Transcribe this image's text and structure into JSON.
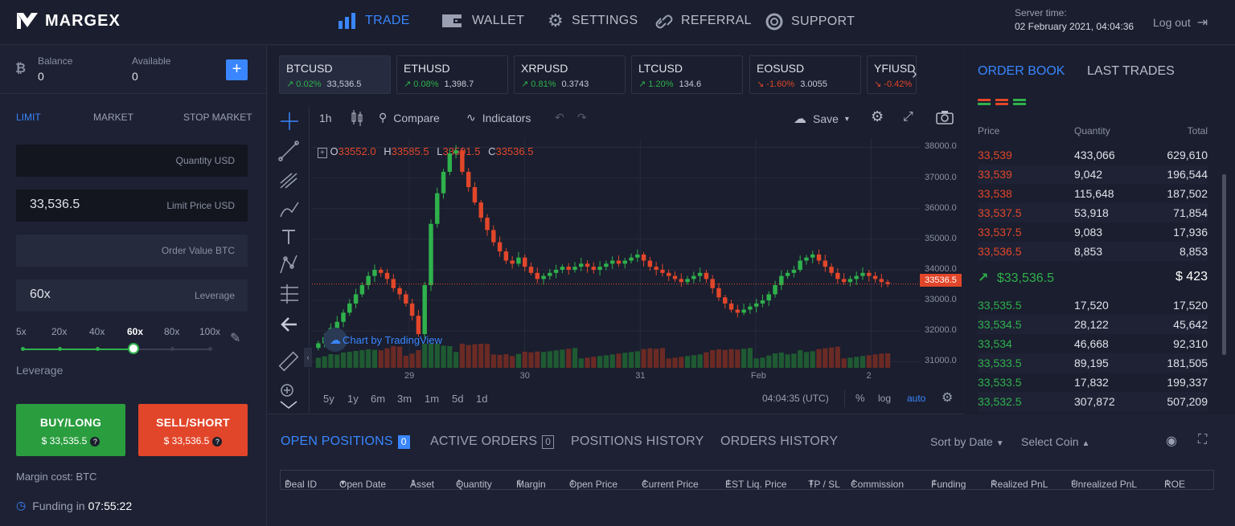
{
  "header": {
    "brand": "MARGEX",
    "nav": [
      {
        "label": "TRADE",
        "icon": "bar-chart-icon",
        "active": true
      },
      {
        "label": "WALLET",
        "icon": "wallet-icon",
        "active": false
      },
      {
        "label": "SETTINGS",
        "icon": "gear-icon",
        "active": false
      },
      {
        "label": "REFERRAL",
        "icon": "link-icon",
        "active": false
      },
      {
        "label": "SUPPORT",
        "icon": "lifebuoy-icon",
        "active": false
      }
    ],
    "server_time_label": "Server time:",
    "server_time_value": "02 February 2021, 04:04:36",
    "logout": "Log out"
  },
  "account": {
    "balance_label": "Balance",
    "balance_value": "0",
    "available_label": "Available",
    "available_value": "0",
    "add_symbol": "+"
  },
  "order_form": {
    "tabs": [
      "LIMIT",
      "MARKET",
      "STOP MARKET"
    ],
    "active_tab": "LIMIT",
    "quantity_placeholder": "Quantity USD",
    "limit_price_value": "33,536.5",
    "limit_price_placeholder": "Limit Price USD",
    "order_value_placeholder": "Order Value BTC",
    "leverage_value": "60x",
    "leverage_placeholder": "Leverage",
    "leverage_levels": [
      "5x",
      "20x",
      "40x",
      "60x",
      "80x",
      "100x"
    ],
    "leverage_selected": "60x",
    "leverage_caption": "Leverage",
    "buy_label": "BUY/LONG",
    "buy_price": "$ 33,535.5",
    "sell_label": "SELL/SHORT",
    "sell_price": "$ 33,536.5",
    "help_symbol": "?",
    "margin_cost": "Margin cost: BTC",
    "funding_label": "Funding in",
    "funding_value": "07:55:22"
  },
  "tickers": [
    {
      "symbol": "BTCUSD",
      "change": "0.02%",
      "price": "33,536.5",
      "dir": "up"
    },
    {
      "symbol": "ETHUSD",
      "change": "0.08%",
      "price": "1,398.7",
      "dir": "up"
    },
    {
      "symbol": "XRPUSD",
      "change": "0.81%",
      "price": "0.3743",
      "dir": "up"
    },
    {
      "symbol": "LTCUSD",
      "change": "1.20%",
      "price": "134.6",
      "dir": "up"
    },
    {
      "symbol": "EOSUSD",
      "change": "-1.60%",
      "price": "3.0055",
      "dir": "down"
    },
    {
      "symbol": "YFIUSD",
      "change": "-0.42%",
      "price": "3...",
      "dir": "down"
    }
  ],
  "chart_toolbar": {
    "interval": "1h",
    "compare": "Compare",
    "indicators": "Indicators",
    "save": "Save"
  },
  "ohlc": {
    "o": "33552.0",
    "h": "33585.5",
    "l": "33501.5",
    "c": "33536.5"
  },
  "watermark": "Chart by TradingView",
  "chart_data": {
    "type": "candlestick",
    "x_ticks": [
      "29",
      "30",
      "31",
      "Feb",
      "2"
    ],
    "y_ticks": [
      "38000.0",
      "37000.0",
      "36000.0",
      "35000.0",
      "34000.0",
      "33000.0",
      "32000.0",
      "31000.0"
    ],
    "ylim": [
      30800,
      38300
    ],
    "last_price": "33536.5",
    "closes": [
      31600,
      31800,
      32100,
      32300,
      32600,
      32900,
      33200,
      33500,
      33800,
      34000,
      33900,
      33700,
      33400,
      33200,
      32900,
      32500,
      31900,
      33500,
      35500,
      36500,
      37200,
      37800,
      37900,
      37200,
      36700,
      36200,
      35700,
      35300,
      34900,
      34600,
      34300,
      34200,
      34400,
      34100,
      33900,
      33700,
      33800,
      33900,
      34000,
      34100,
      34000,
      34100,
      34200,
      34100,
      34000,
      34100,
      34200,
      34300,
      34200,
      34300,
      34400,
      34500,
      34300,
      34100,
      34000,
      33900,
      33800,
      33700,
      33600,
      33700,
      33800,
      33900,
      33700,
      33400,
      33100,
      32900,
      32700,
      32600,
      32700,
      32800,
      32900,
      33000,
      33200,
      33500,
      33800,
      33900,
      34000,
      34300,
      34400,
      34500,
      34300,
      34100,
      33900,
      33700,
      33600,
      33700,
      33800,
      33900,
      33800,
      33700,
      33600,
      33536
    ]
  },
  "timeframes": [
    "5y",
    "1y",
    "6m",
    "3m",
    "1m",
    "5d",
    "1d"
  ],
  "chart_footer": {
    "time": "04:04:35 (UTC)",
    "pct": "%",
    "log": "log",
    "auto": "auto"
  },
  "order_book": {
    "tabs": [
      "ORDER BOOK",
      "LAST TRADES"
    ],
    "headers": {
      "price": "Price",
      "quantity": "Quantity",
      "total": "Total"
    },
    "asks": [
      {
        "price": "33,539",
        "qty": "433,066",
        "total": "629,610"
      },
      {
        "price": "33,539",
        "qty": "9,042",
        "total": "196,544"
      },
      {
        "price": "33,538",
        "qty": "115,648",
        "total": "187,502"
      },
      {
        "price": "33,537.5",
        "qty": "53,918",
        "total": "71,854"
      },
      {
        "price": "33,537.5",
        "qty": "9,083",
        "total": "17,936"
      },
      {
        "price": "33,536.5",
        "qty": "8,853",
        "total": "8,853"
      }
    ],
    "mid_price": "$33,536.5",
    "mid_value": "$ 423",
    "bids": [
      {
        "price": "33,535.5",
        "qty": "17,520",
        "total": "17,520"
      },
      {
        "price": "33,534.5",
        "qty": "28,122",
        "total": "45,642"
      },
      {
        "price": "33,534",
        "qty": "46,668",
        "total": "92,310"
      },
      {
        "price": "33,533.5",
        "qty": "89,195",
        "total": "181,505"
      },
      {
        "price": "33,533.5",
        "qty": "17,832",
        "total": "199,337"
      },
      {
        "price": "33,532.5",
        "qty": "307,872",
        "total": "507,209"
      }
    ]
  },
  "positions": {
    "tabs": [
      {
        "label": "OPEN POSITIONS",
        "count": "0",
        "active": true
      },
      {
        "label": "ACTIVE ORDERS",
        "count": "0",
        "active": false
      },
      {
        "label": "POSITIONS HISTORY",
        "count": null,
        "active": false
      },
      {
        "label": "ORDERS HISTORY",
        "count": null,
        "active": false
      }
    ],
    "sort": "Sort by Date",
    "select_coin": "Select Coin",
    "columns": [
      "Deal ID",
      "Open Date",
      "Asset",
      "Quantity",
      "Margin",
      "Open Price",
      "Current Price",
      "EST Liq. Price",
      "TP / SL",
      "Commission",
      "Funding",
      "Realized PnL",
      "Unrealized PnL",
      "ROE"
    ]
  },
  "colors": {
    "accent": "#3a86ff",
    "up": "#2fb14c",
    "down": "#e2462a"
  }
}
